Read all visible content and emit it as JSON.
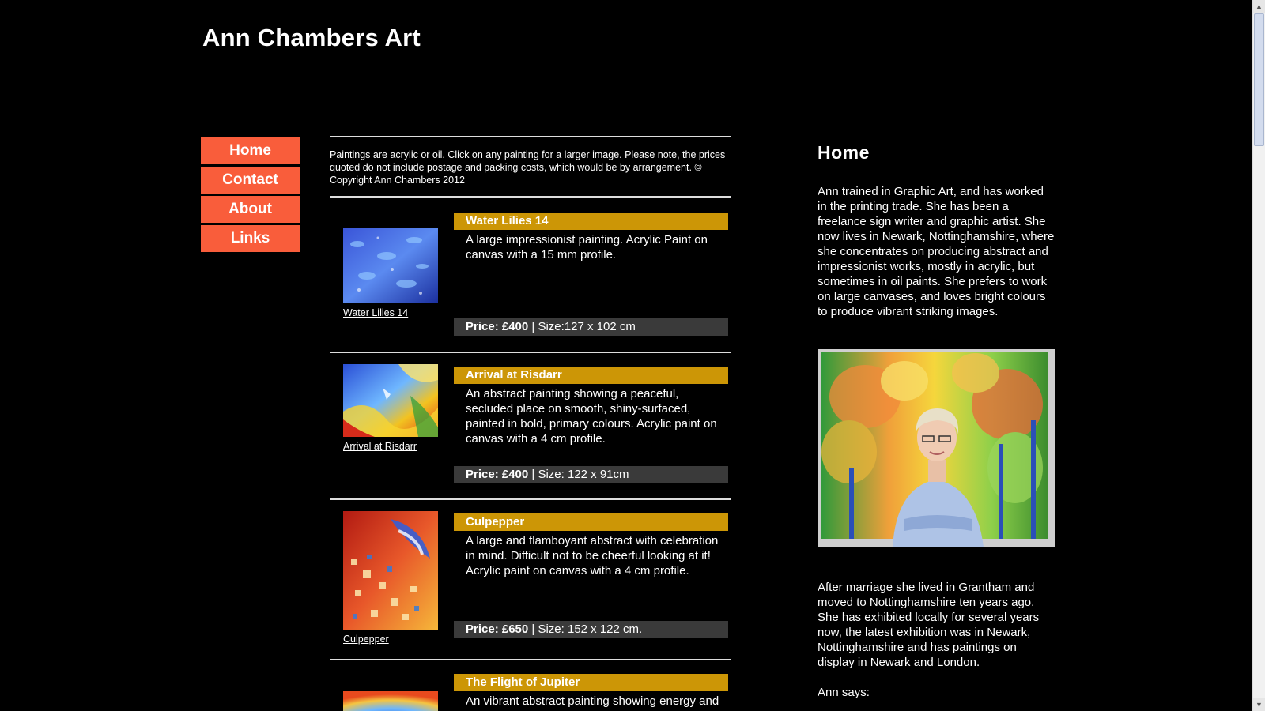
{
  "site": {
    "title": "Ann Chambers Art"
  },
  "nav": {
    "items": [
      {
        "label": "Home"
      },
      {
        "label": "Contact"
      },
      {
        "label": "About"
      },
      {
        "label": "Links"
      }
    ]
  },
  "colors": {
    "nav_bg": "#f95d3b",
    "title_bar": "#cc9606",
    "price_bar": "#3a3a3a",
    "background": "#000000"
  },
  "gallery": {
    "intro": "Paintings are acrylic or oil. Click on any painting for a larger image. Please note, the prices quoted do not include postage and packing costs, which would be by arrangement. © Copyright Ann Chambers 2012",
    "paintings": [
      {
        "title": "Water Lilies 14",
        "caption": "Water Lilies 14",
        "description": "A large impressionist painting. Acrylic Paint on canvas with a 15 mm profile.",
        "price_label": "Price: £400",
        "size_text": " | Size:127 x 102 cm"
      },
      {
        "title": "Arrival at Risdarr",
        "caption": "Arrival at Risdarr",
        "description": "An abstract painting showing a peaceful, secluded place on smooth, shiny-surfaced, painted in bold, primary colours. Acrylic paint on canvas with a 4 cm profile.",
        "price_label": "Price: £400",
        "size_text": " | Size: 122 x 91cm"
      },
      {
        "title": "Culpepper",
        "caption": "Culpepper",
        "description": "A large and flamboyant abstract with celebration in mind. Difficult not to be cheerful looking at it! Acrylic paint on canvas with a 4 cm profile.",
        "price_label": "Price: £650",
        "size_text": " | Size: 152 x 122 cm."
      },
      {
        "title": "The Flight of Jupiter",
        "caption": "",
        "description": "An vibrant abstract painting showing energy and"
      }
    ]
  },
  "about": {
    "heading": "Home",
    "para1": "Ann trained in Graphic Art, and has worked in the printing trade. She has been a freelance sign writer and graphic artist. She now lives in Newark, Nottinghamshire, where she concentrates on producing abstract and impressionist works, mostly in acrylic, but sometimes in oil paints. She prefers to work on large canvases, and loves bright colours to produce vibrant striking images.",
    "para2": "After marriage she lived in Grantham and moved to Nottinghamshire ten years ago. She has exhibited locally for several years now, the latest exhibition was in Newark, Nottinghamshire and has paintings on display in Newark and London.",
    "para3": "Ann says:"
  }
}
